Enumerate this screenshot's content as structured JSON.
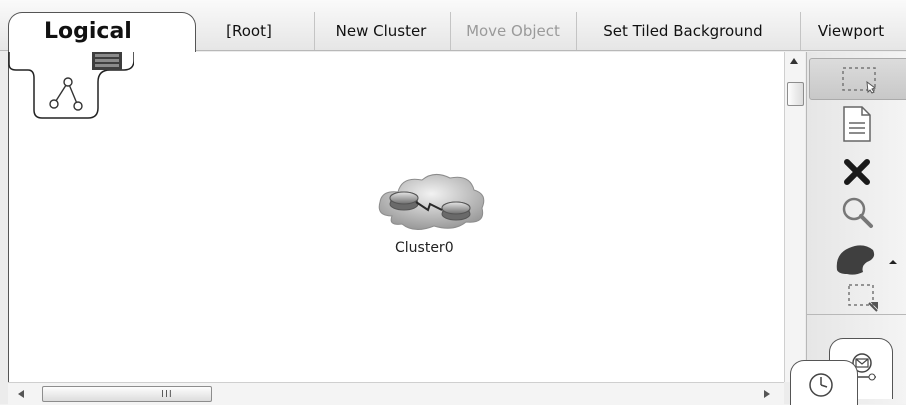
{
  "toolbar": {
    "logical_tab": "Logical",
    "root": "[Root]",
    "new_cluster": "New Cluster",
    "move_object": "Move Object",
    "set_tiled_background": "Set Tiled Background",
    "viewport": "Viewport"
  },
  "workspace": {
    "cluster_label": "Cluster0"
  },
  "scrollbar": {
    "grip": "III"
  },
  "tools": [
    {
      "name": "select-tool",
      "icon": "dashed-select-icon"
    },
    {
      "name": "note-tool",
      "icon": "note-icon"
    },
    {
      "name": "delete-tool",
      "icon": "delete-x-icon"
    },
    {
      "name": "inspect-tool",
      "icon": "magnifier-icon"
    },
    {
      "name": "draw-shape-tool",
      "icon": "shape-palette-icon"
    },
    {
      "name": "resize-shape-tool",
      "icon": "resize-select-icon"
    },
    {
      "name": "add-pdu-tool",
      "icon": "pdu-envelope-icon"
    }
  ],
  "colors": {
    "delete_icon": "#1a1a1a",
    "disabled_text": "#9a9a9a"
  }
}
